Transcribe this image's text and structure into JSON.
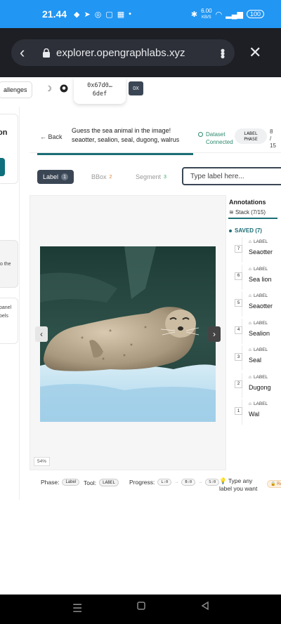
{
  "status_bar": {
    "time": "21.44",
    "net_speed": "6.00",
    "net_unit": "KB/S",
    "battery": "100"
  },
  "browser": {
    "url": "explorer.opengraphlabs.xyz"
  },
  "topnav": {
    "challenges_label": "allenges",
    "address_line1": "0x67d0…",
    "address_line2": "6def",
    "ox_label": "0X"
  },
  "left_column": {
    "card1_text": "on",
    "card2_text": "o the",
    "card3_line1": "panel",
    "card3_line2": "bels"
  },
  "task": {
    "back_label": "Back",
    "prompt": "Guess the sea animal in the image! seaotter, sealion, seal, dugong, walrus",
    "dataset_line1": "Dataset",
    "dataset_line2": "Connected",
    "phase_line1": "LABEL",
    "phase_line2": "PHASE",
    "count_line1": "8",
    "count_line2": "/",
    "count_line3": "15",
    "progress": 0.53
  },
  "tabs": [
    {
      "label": "Label",
      "num": "1"
    },
    {
      "label": "BBox",
      "num": "2"
    },
    {
      "label": "Segment",
      "num": "3"
    }
  ],
  "label_input": {
    "placeholder": "Type label here..."
  },
  "canvas": {
    "zoom": "54%",
    "prev_arrow": "‹",
    "next_arrow": "›"
  },
  "annotations": {
    "title": "Annotations",
    "stack_label": "Stack (7/15)",
    "saved_label": "SAVED (7)",
    "tag_label": "LABEL",
    "items": [
      {
        "num": "7",
        "name": "Seaotter"
      },
      {
        "num": "6",
        "name": "Sea lion"
      },
      {
        "num": "5",
        "name": "Seaotter"
      },
      {
        "num": "4",
        "name": "Sealion"
      },
      {
        "num": "3",
        "name": "Seal"
      },
      {
        "num": "2",
        "name": "Dugong"
      },
      {
        "num": "1",
        "name": "Wal"
      }
    ]
  },
  "footer": {
    "phase_label": "Phase:",
    "phase_value": "Label",
    "tool_label": "Tool:",
    "tool_value": "LABEL",
    "progress_label": "Progress:",
    "l_value": "L:0",
    "b_value": "B:0",
    "s_value": "S:0",
    "hint": "Type any label you want",
    "badge": "Re"
  },
  "colors": {
    "accent": "#1b6e75",
    "dark_button": "#3b4655",
    "status_bar": "#2196f3",
    "browser_bar": "#1d1f24"
  }
}
